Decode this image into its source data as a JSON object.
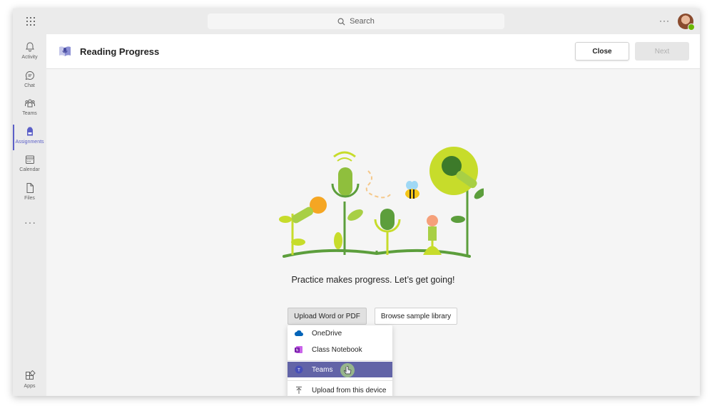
{
  "topbar": {
    "search_placeholder": "Search",
    "more": "···"
  },
  "rail": {
    "items": [
      {
        "label": "Activity",
        "icon": "bell-icon"
      },
      {
        "label": "Chat",
        "icon": "chat-icon"
      },
      {
        "label": "Teams",
        "icon": "teams-icon"
      },
      {
        "label": "Assignments",
        "icon": "backpack-icon",
        "active": true
      },
      {
        "label": "Calendar",
        "icon": "calendar-icon"
      },
      {
        "label": "Files",
        "icon": "file-icon"
      }
    ],
    "more": "···",
    "apps_label": "Apps"
  },
  "header": {
    "title": "Reading Progress",
    "close_label": "Close",
    "next_label": "Next"
  },
  "main": {
    "tagline": "Practice makes progress. Let’s get going!",
    "upload_label": "Upload Word or PDF",
    "browse_label": "Browse sample library"
  },
  "menu": {
    "items": [
      {
        "label": "OneDrive",
        "icon": "onedrive-icon"
      },
      {
        "label": "Class Notebook",
        "icon": "onenote-icon"
      },
      {
        "label": "Teams",
        "icon": "teams-app-icon",
        "highlighted": true
      },
      {
        "label": "Upload from this device",
        "icon": "upload-icon"
      }
    ]
  },
  "colors": {
    "accent": "#5b5fc7",
    "highlight": "#6264a7",
    "plant_green": "#5c9e3c",
    "lime": "#c7dc2b",
    "orange": "#f5a623"
  }
}
